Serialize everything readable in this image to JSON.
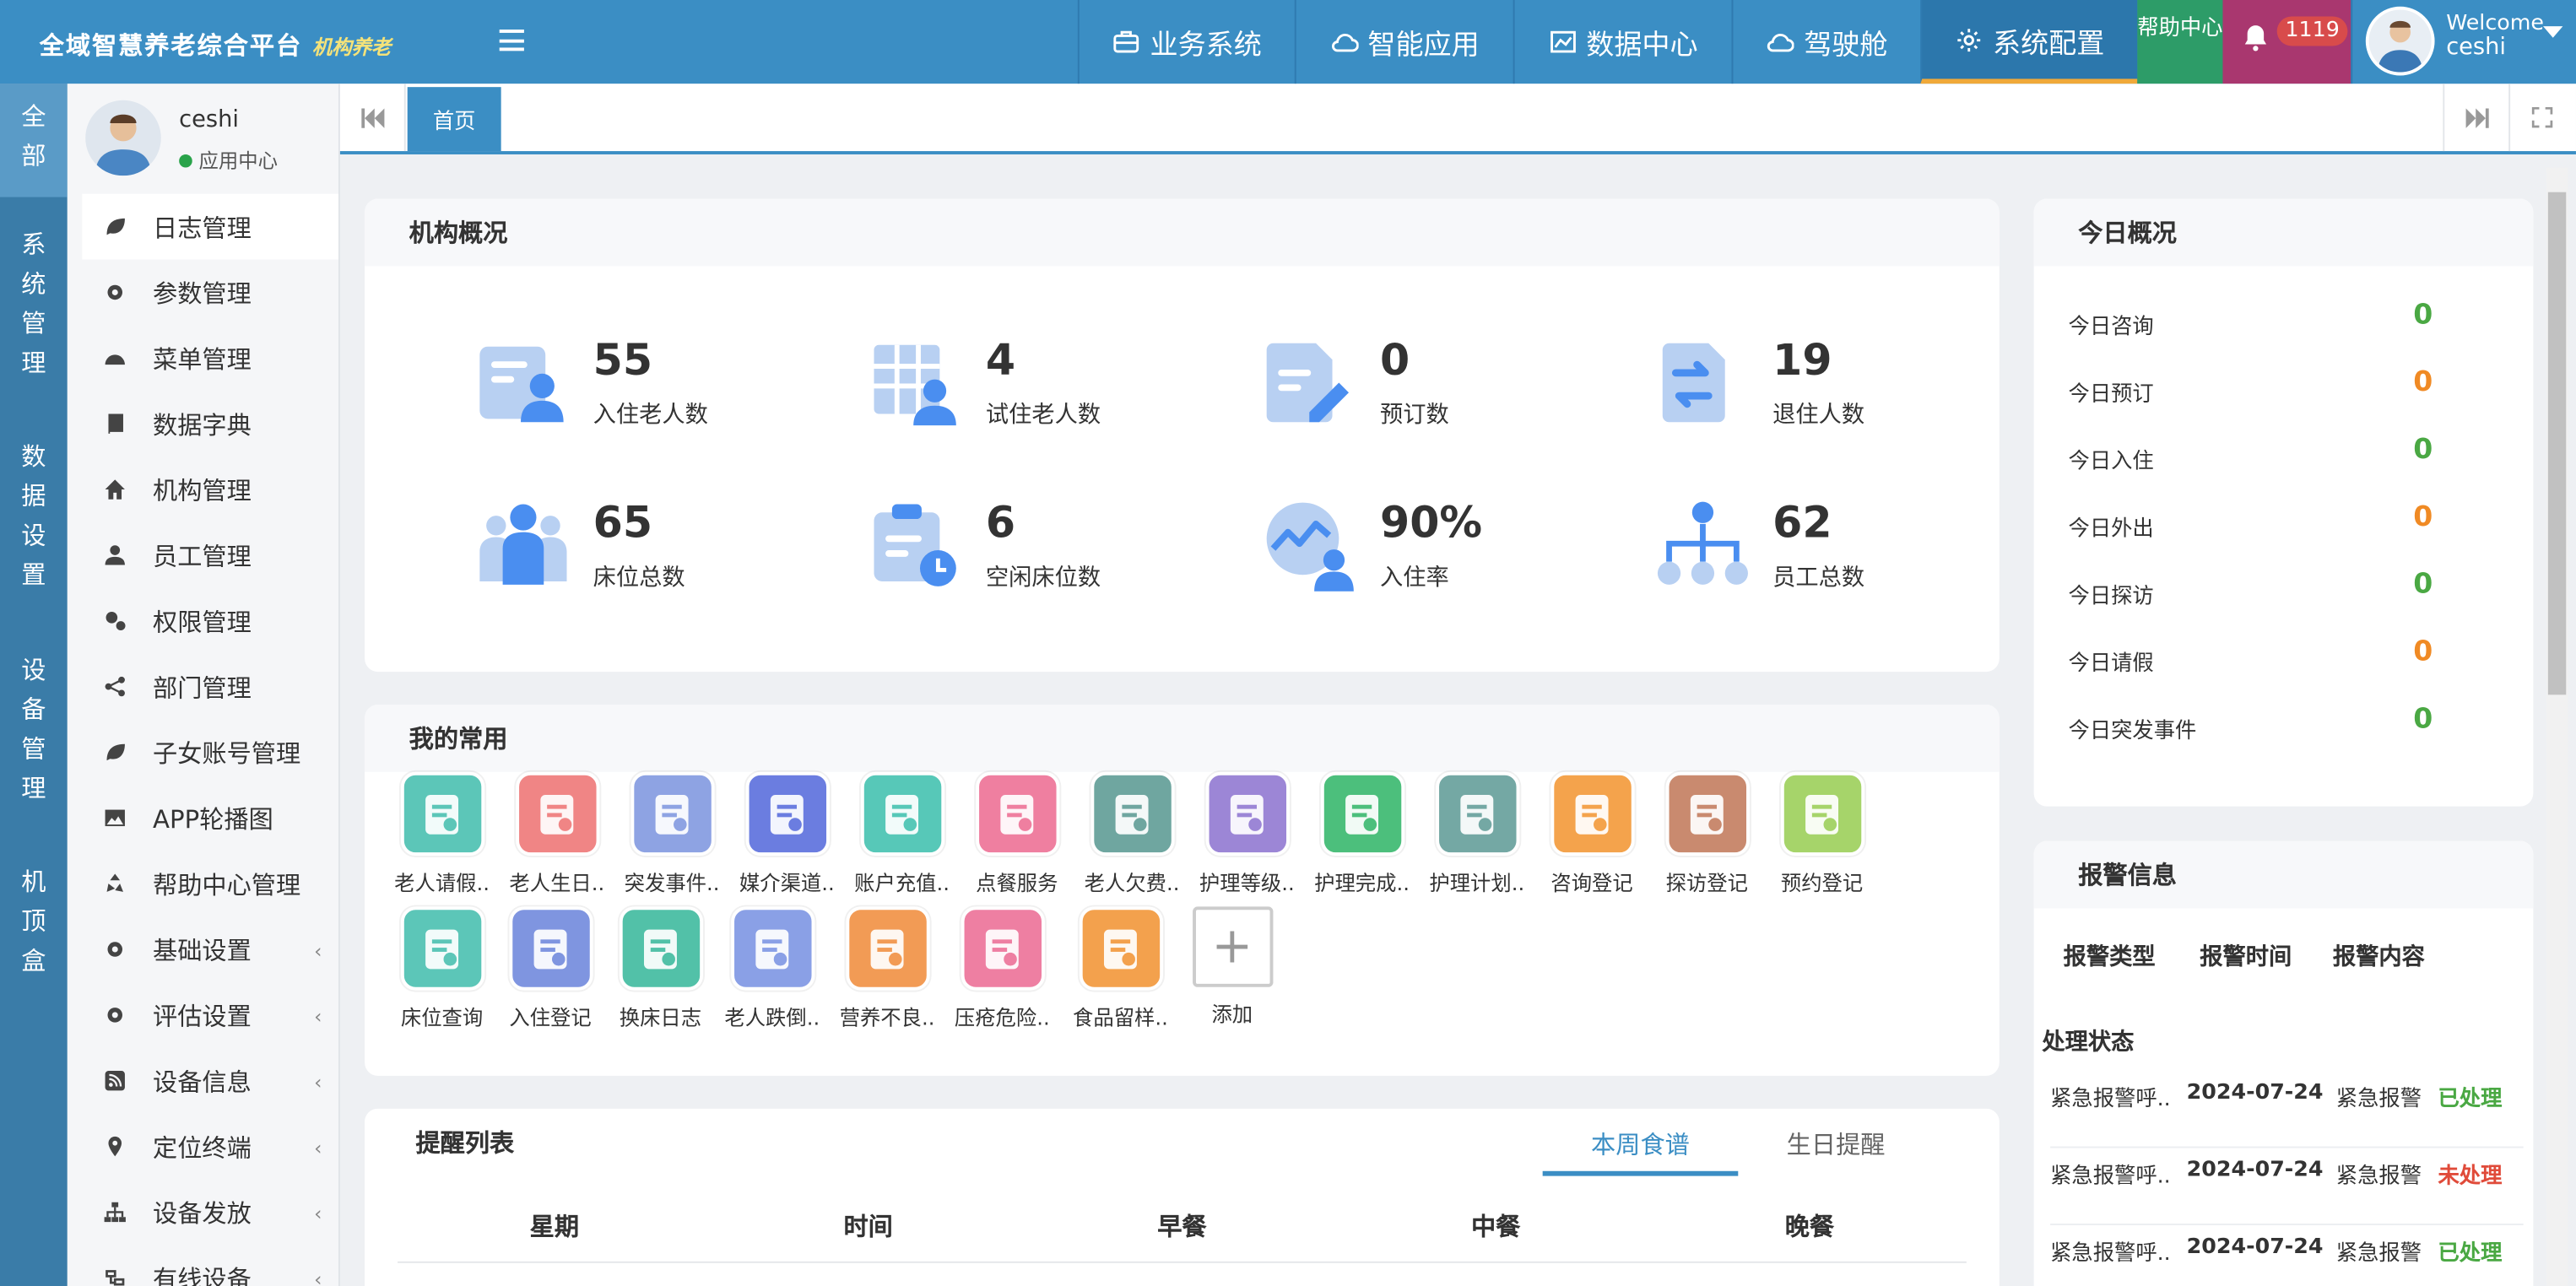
{
  "brand": {
    "title": "全域智慧养老综合平台",
    "tag": "机构养老"
  },
  "topnav": [
    {
      "label": "业务系统",
      "icon": "briefcase-icon"
    },
    {
      "label": "智能应用",
      "icon": "cloud-icon"
    },
    {
      "label": "数据中心",
      "icon": "chart-icon"
    },
    {
      "label": "驾驶舱",
      "icon": "cloud-icon"
    },
    {
      "label": "系统配置",
      "icon": "gear-icon"
    }
  ],
  "help": {
    "label": "帮助中心"
  },
  "notifications": {
    "count": "1119"
  },
  "user": {
    "welcome": "Welcome",
    "name": "ceshi"
  },
  "rail": [
    "全部",
    "系统管理",
    "数据设置",
    "设备管理",
    "机顶盒"
  ],
  "profile": {
    "name": "ceshi",
    "status": "应用中心"
  },
  "menu": [
    {
      "label": "日志管理",
      "icon": "leaf-icon"
    },
    {
      "label": "参数管理",
      "icon": "gear-icon"
    },
    {
      "label": "菜单管理",
      "icon": "dashboard-icon"
    },
    {
      "label": "数据字典",
      "icon": "book-icon"
    },
    {
      "label": "机构管理",
      "icon": "home-icon"
    },
    {
      "label": "员工管理",
      "icon": "user-icon"
    },
    {
      "label": "权限管理",
      "icon": "gears-icon"
    },
    {
      "label": "部门管理",
      "icon": "share-icon"
    },
    {
      "label": "子女账号管理",
      "icon": "leaf-icon"
    },
    {
      "label": "APP轮播图",
      "icon": "image-icon"
    },
    {
      "label": "帮助中心管理",
      "icon": "recycle-icon"
    },
    {
      "label": "基础设置",
      "icon": "gear-icon",
      "arrow": "‹"
    },
    {
      "label": "评估设置",
      "icon": "gear-icon",
      "arrow": "‹"
    },
    {
      "label": "设备信息",
      "icon": "rss-icon",
      "arrow": "‹"
    },
    {
      "label": "定位终端",
      "icon": "pin-icon",
      "arrow": "‹"
    },
    {
      "label": "设备发放",
      "icon": "sitemap-icon",
      "arrow": "‹"
    },
    {
      "label": "有线设备",
      "icon": "cable-icon",
      "arrow": "‹"
    }
  ],
  "tabs": {
    "home": "首页"
  },
  "overview": {
    "title": "机构概况",
    "stats": [
      {
        "value": "55",
        "label": "入住老人数",
        "icon": "checkin-icon"
      },
      {
        "value": "4",
        "label": "试住老人数",
        "icon": "trial-icon"
      },
      {
        "value": "0",
        "label": "预订数",
        "icon": "booking-icon"
      },
      {
        "value": "19",
        "label": "退住人数",
        "icon": "checkout-icon"
      },
      {
        "value": "65",
        "label": "床位总数",
        "icon": "beds-icon"
      },
      {
        "value": "6",
        "label": "空闲床位数",
        "icon": "free-bed-icon"
      },
      {
        "value": "90%",
        "label": "入住率",
        "icon": "occupancy-icon"
      },
      {
        "value": "62",
        "label": "员工总数",
        "icon": "staff-icon"
      }
    ]
  },
  "favorites": {
    "title": "我的常用",
    "items": [
      {
        "label": "老人请假..",
        "color": "#5cc6b8"
      },
      {
        "label": "老人生日..",
        "color": "#f08585"
      },
      {
        "label": "突发事件..",
        "color": "#8ea3e3"
      },
      {
        "label": "媒介渠道..",
        "color": "#6b7de0"
      },
      {
        "label": "账户充值..",
        "color": "#57c8b8"
      },
      {
        "label": "点餐服务",
        "color": "#ef7fa0"
      },
      {
        "label": "老人欠费..",
        "color": "#6fa6a0"
      },
      {
        "label": "护理等级..",
        "color": "#9c86d6"
      },
      {
        "label": "护理完成..",
        "color": "#4cbf7c"
      },
      {
        "label": "护理计划..",
        "color": "#74a8a4"
      },
      {
        "label": "咨询登记",
        "color": "#f4a34c"
      },
      {
        "label": "探访登记",
        "color": "#c98a6f"
      },
      {
        "label": "预约登记",
        "color": "#a6d46a"
      },
      {
        "label": "床位查询",
        "color": "#5cc6b8"
      },
      {
        "label": "入住登记",
        "color": "#7f95e0"
      },
      {
        "label": "换床日志",
        "color": "#52c1a8"
      },
      {
        "label": "老人跌倒..",
        "color": "#8aa0e6"
      },
      {
        "label": "营养不良..",
        "color": "#f29b55"
      },
      {
        "label": "压疮危险..",
        "color": "#ee7fa2"
      },
      {
        "label": "食品留样..",
        "color": "#f3a14d"
      }
    ],
    "add_label": "添加"
  },
  "reminders": {
    "title": "提醒列表",
    "tabs": [
      "本周食谱",
      "生日提醒"
    ],
    "columns": [
      "星期",
      "时间",
      "早餐",
      "中餐",
      "晚餐"
    ]
  },
  "today": {
    "title": "今日概况",
    "rows": [
      {
        "label": "今日咨询",
        "value": "0",
        "color": "#4aa843"
      },
      {
        "label": "今日预订",
        "value": "0",
        "color": "#f08a24"
      },
      {
        "label": "今日入住",
        "value": "0",
        "color": "#4aa843"
      },
      {
        "label": "今日外出",
        "value": "0",
        "color": "#f08a24"
      },
      {
        "label": "今日探访",
        "value": "0",
        "color": "#4aa843"
      },
      {
        "label": "今日请假",
        "value": "0",
        "color": "#f08a24"
      },
      {
        "label": "今日突发事件",
        "value": "0",
        "color": "#4aa843"
      }
    ]
  },
  "alarms": {
    "title": "报警信息",
    "columns": [
      "报警类型",
      "报警时间",
      "报警内容",
      "处理状态"
    ],
    "rows": [
      {
        "type": "紧急报警呼..",
        "time": "2024-07-24",
        "content": "紧急报警",
        "status": "已处理",
        "status_color": "#4aa843"
      },
      {
        "type": "紧急报警呼..",
        "time": "2024-07-24",
        "content": "紧急报警",
        "status": "未处理",
        "status_color": "#e04b3a"
      },
      {
        "type": "紧急报警呼..",
        "time": "2024-07-24",
        "content": "紧急报警",
        "status": "已处理",
        "status_color": "#4aa843"
      }
    ]
  }
}
